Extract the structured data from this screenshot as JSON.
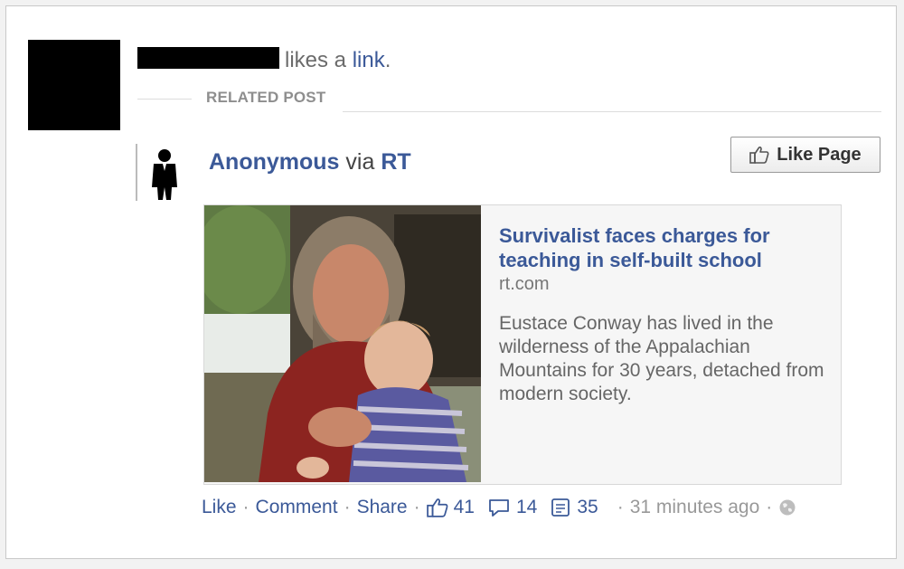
{
  "story": {
    "actor_text": "likes a",
    "link_text": "link",
    "period": "."
  },
  "related_label": "RELATED POST",
  "post": {
    "author": "Anonymous",
    "via": "via",
    "source_name": "RT"
  },
  "like_page": {
    "label": "Like Page",
    "icon": "thumbs-up-icon"
  },
  "attachment": {
    "title": "Survivalist faces charges for teaching in self-built school",
    "source": "rt.com",
    "description": "Eustace Conway has lived in the wilderness of the Appalachian Mountains for 30 years, detached from modern society."
  },
  "footer": {
    "like": "Like",
    "comment": "Comment",
    "share": "Share",
    "likes_count": "41",
    "comments_count": "14",
    "shares_count": "35",
    "time": "31 minutes ago",
    "separator": "·"
  },
  "colors": {
    "link": "#3b5998",
    "muted": "#999999"
  }
}
